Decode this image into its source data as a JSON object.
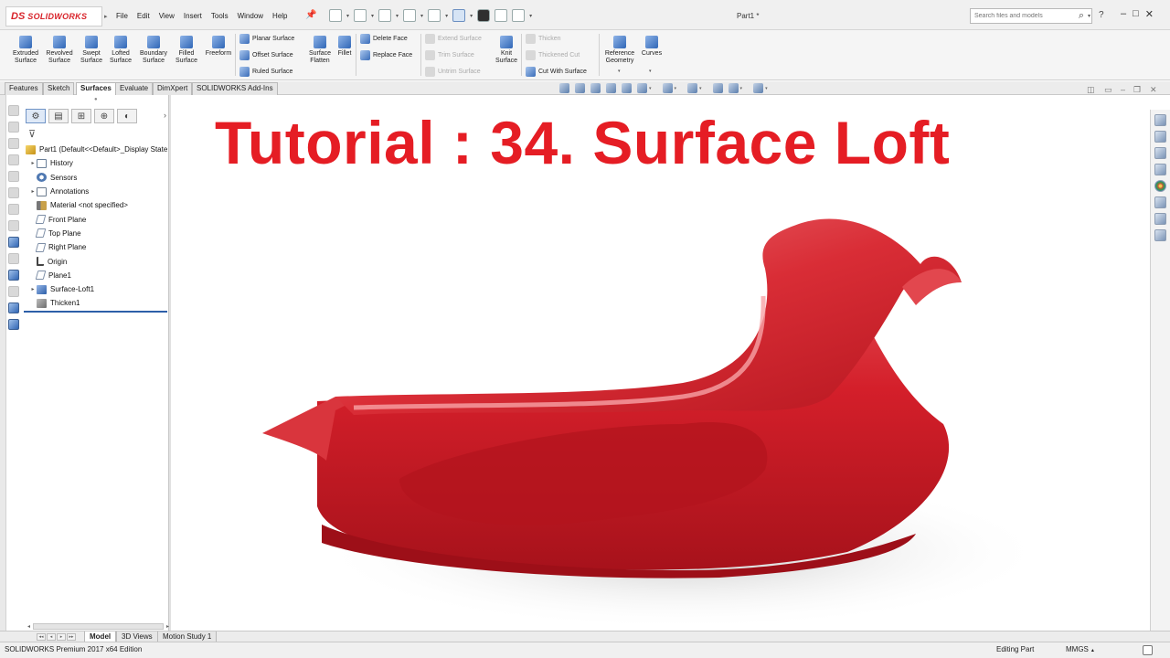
{
  "app": {
    "logo_prefix": "DS",
    "logo_text": "SOLIDWORKS",
    "document_title": "Part1 *"
  },
  "menu": [
    "File",
    "Edit",
    "View",
    "Insert",
    "Tools",
    "Window",
    "Help"
  ],
  "search": {
    "placeholder": "Search files and models"
  },
  "help_label": "?",
  "ribbon": {
    "big_buttons": [
      {
        "label": "Extruded Surface",
        "icon": "extruded-surface-icon"
      },
      {
        "label": "Revolved Surface",
        "icon": "revolved-surface-icon"
      },
      {
        "label": "Swept Surface",
        "icon": "swept-surface-icon"
      },
      {
        "label": "Lofted Surface",
        "icon": "lofted-surface-icon"
      },
      {
        "label": "Boundary Surface",
        "icon": "boundary-surface-icon"
      },
      {
        "label": "Filled Surface",
        "icon": "filled-surface-icon"
      },
      {
        "label": "Freeform",
        "icon": "freeform-icon"
      }
    ],
    "group1": [
      "Planar Surface",
      "Offset Surface",
      "Ruled Surface"
    ],
    "surface_flatten": "Surface Flatten",
    "fillet": "Fillet",
    "group2": [
      "Delete Face",
      "Replace Face"
    ],
    "group3_disabled": [
      "Extend Surface",
      "Trim Surface",
      "Untrim Surface"
    ],
    "knit_surface": "Knit Surface",
    "group4": [
      {
        "label": "Thicken",
        "enabled": false
      },
      {
        "label": "Thickened Cut",
        "enabled": false
      },
      {
        "label": "Cut With Surface",
        "enabled": true
      }
    ],
    "reference_geometry": "Reference Geometry",
    "curves": "Curves"
  },
  "command_tabs": [
    "Features",
    "Sketch",
    "Surfaces",
    "Evaluate",
    "DimXpert",
    "SOLIDWORKS Add-Ins"
  ],
  "active_command_tab": "Surfaces",
  "feature_tree": {
    "root": "Part1  (Default<<Default>_Display State",
    "items": [
      {
        "label": "History",
        "expandable": true,
        "icon": "folder-icon"
      },
      {
        "label": "Sensors",
        "expandable": false,
        "icon": "sensor-icon"
      },
      {
        "label": "Annotations",
        "expandable": true,
        "icon": "annotations-icon"
      },
      {
        "label": "Material <not specified>",
        "expandable": false,
        "icon": "material-icon"
      },
      {
        "label": "Front Plane",
        "expandable": false,
        "icon": "plane-icon"
      },
      {
        "label": "Top Plane",
        "expandable": false,
        "icon": "plane-icon"
      },
      {
        "label": "Right Plane",
        "expandable": false,
        "icon": "plane-icon"
      },
      {
        "label": "Origin",
        "expandable": false,
        "icon": "origin-icon"
      },
      {
        "label": "Plane1",
        "expandable": false,
        "icon": "plane-icon"
      },
      {
        "label": "Surface-Loft1",
        "expandable": true,
        "icon": "surface-loft-icon"
      },
      {
        "label": "Thicken1",
        "expandable": false,
        "icon": "thicken-icon"
      }
    ]
  },
  "viewport": {
    "overlay_title": "Tutorial : 34. Surface Loft",
    "model_color": "#d41f2a"
  },
  "bottom_tabs": [
    "Model",
    "3D Views",
    "Motion Study 1"
  ],
  "active_bottom_tab": "Model",
  "status": {
    "edition": "SOLIDWORKS Premium 2017 x64 Edition",
    "mode": "Editing Part",
    "units": "MMGS"
  }
}
